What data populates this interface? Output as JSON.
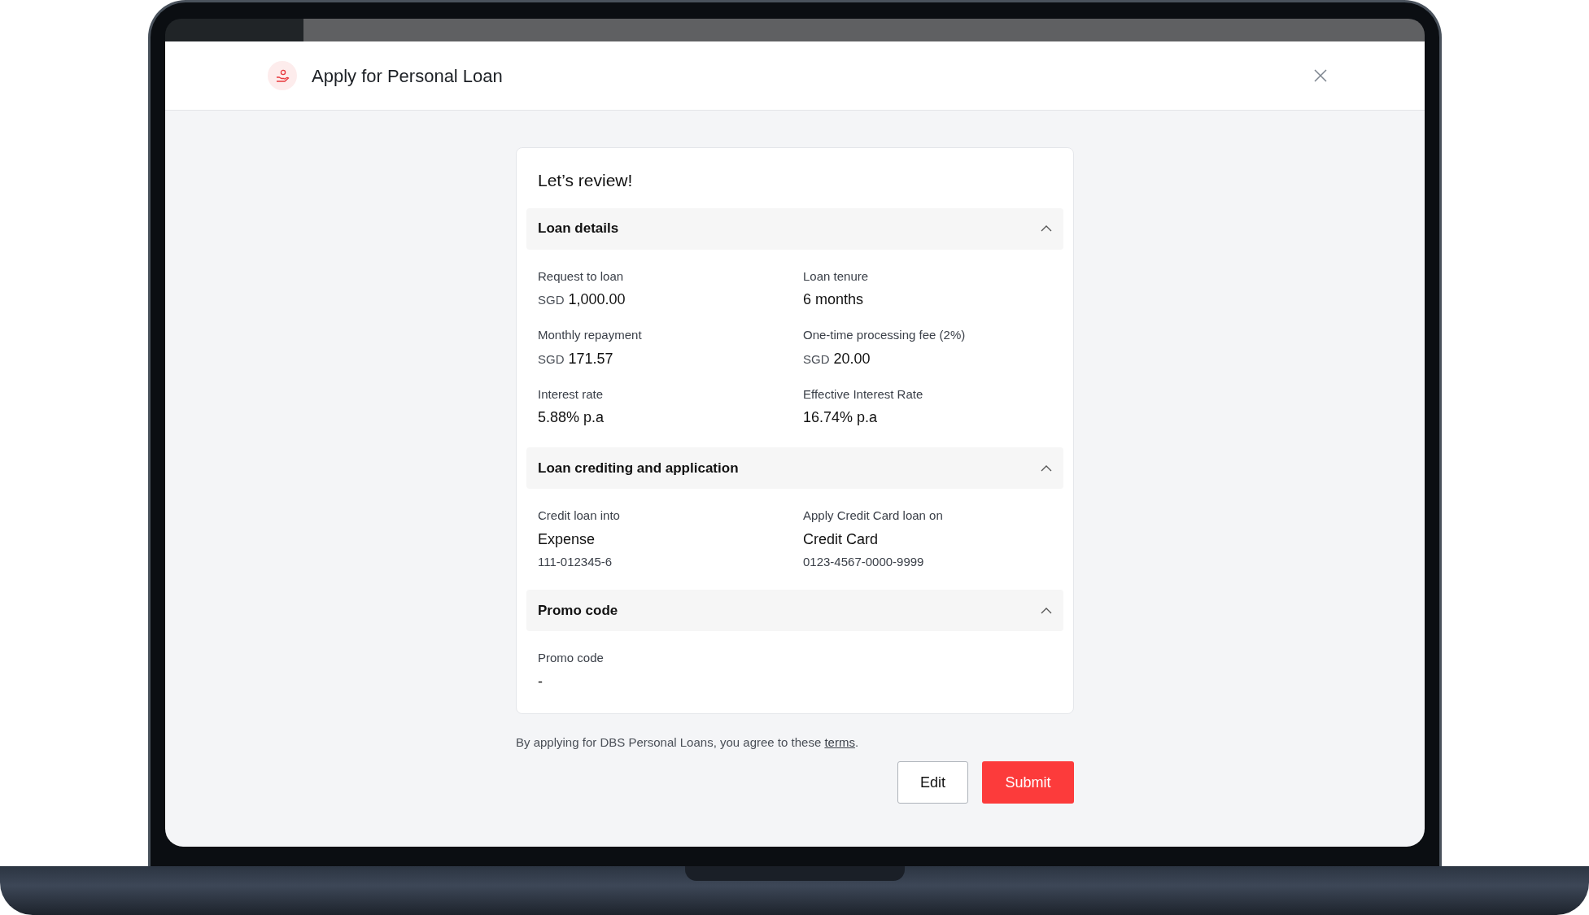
{
  "modal": {
    "title": "Apply for Personal Loan"
  },
  "review": {
    "title": "Let’s review!",
    "sections": [
      {
        "title": "Loan details",
        "expanded": true,
        "items": [
          {
            "label": "Request to loan",
            "currency": "SGD",
            "value": "1,000.00"
          },
          {
            "label": "Loan tenure",
            "value": "6 months"
          },
          {
            "label": "Monthly repayment",
            "currency": "SGD",
            "value": "171.57"
          },
          {
            "label": "One-time processing fee (2%)",
            "currency": "SGD",
            "value": "20.00"
          },
          {
            "label": "Interest rate",
            "value": "5.88% p.a"
          },
          {
            "label": "Effective Interest Rate",
            "value": "16.74% p.a"
          }
        ]
      },
      {
        "title": "Loan crediting and application",
        "expanded": true,
        "items": [
          {
            "label": "Credit loan into",
            "value": "Expense",
            "detail": "111-012345-6"
          },
          {
            "label": "Apply Credit Card loan on",
            "value": "Credit Card",
            "detail": "0123-4567-0000-9999"
          }
        ]
      },
      {
        "title": "Promo code",
        "expanded": true,
        "items": [
          {
            "label": "Promo code",
            "value": "-"
          }
        ]
      }
    ]
  },
  "agreement": {
    "text": "By applying for DBS Personal Loans, you agree to these",
    "link": "terms",
    "end": "."
  },
  "buttons": [
    {
      "label": "Edit",
      "kind": "secondary"
    },
    {
      "label": "Submit",
      "kind": "primary"
    }
  ]
}
